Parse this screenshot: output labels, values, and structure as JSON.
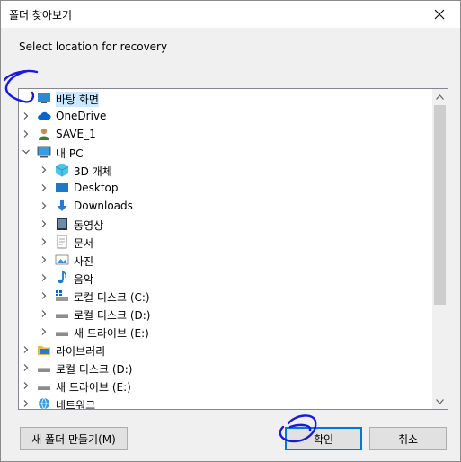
{
  "dialog": {
    "title": "폴더 찾아보기",
    "description": "Select location for recovery"
  },
  "tree": [
    {
      "label": "바탕 화면",
      "icon": "desktop-icon",
      "indent": 0,
      "chevron": "none",
      "selected": true
    },
    {
      "label": "OneDrive",
      "icon": "cloud-icon",
      "indent": 0,
      "chevron": "right"
    },
    {
      "label": "SAVE_1",
      "icon": "user-icon",
      "indent": 0,
      "chevron": "right"
    },
    {
      "label": "내 PC",
      "icon": "computer-icon",
      "indent": 0,
      "chevron": "down"
    },
    {
      "label": "3D 개체",
      "icon": "cube-icon",
      "indent": 1,
      "chevron": "right"
    },
    {
      "label": "Desktop",
      "icon": "desktop-folder-icon",
      "indent": 1,
      "chevron": "right"
    },
    {
      "label": "Downloads",
      "icon": "download-icon",
      "indent": 1,
      "chevron": "right"
    },
    {
      "label": "동영상",
      "icon": "video-icon",
      "indent": 1,
      "chevron": "right"
    },
    {
      "label": "문서",
      "icon": "document-icon",
      "indent": 1,
      "chevron": "right"
    },
    {
      "label": "사진",
      "icon": "picture-icon",
      "indent": 1,
      "chevron": "right"
    },
    {
      "label": "음악",
      "icon": "music-icon",
      "indent": 1,
      "chevron": "right"
    },
    {
      "label": "로컬 디스크 (C:)",
      "icon": "system-drive-icon",
      "indent": 1,
      "chevron": "right"
    },
    {
      "label": "로컬 디스크 (D:)",
      "icon": "drive-icon",
      "indent": 1,
      "chevron": "right"
    },
    {
      "label": "새 드라이브 (E:)",
      "icon": "drive-icon",
      "indent": 1,
      "chevron": "right"
    },
    {
      "label": "라이브러리",
      "icon": "library-icon",
      "indent": 0,
      "chevron": "right"
    },
    {
      "label": "로컬 디스크 (D:)",
      "icon": "drive-icon",
      "indent": 0,
      "chevron": "right"
    },
    {
      "label": "새 드라이브 (E:)",
      "icon": "drive-icon",
      "indent": 0,
      "chevron": "right"
    },
    {
      "label": "네트워크",
      "icon": "network-icon",
      "indent": 0,
      "chevron": "right"
    }
  ],
  "buttons": {
    "new_folder": "새 폴더 만들기(M)",
    "ok": "확인",
    "cancel": "취소"
  },
  "colors": {
    "selection": "#cce8ff",
    "default_button_border": "#0078d7",
    "annotation_ink": "#1a1adb"
  }
}
